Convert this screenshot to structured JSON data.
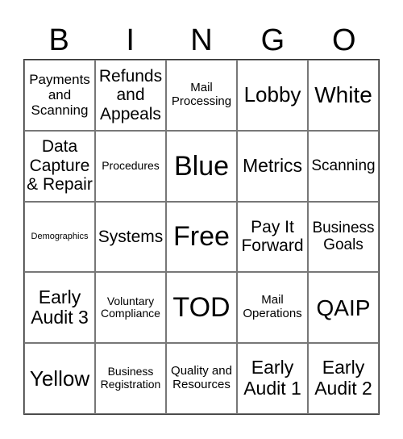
{
  "header": [
    "B",
    "I",
    "N",
    "G",
    "O"
  ],
  "cells": [
    "Payments and Scanning",
    "Refunds and Appeals",
    "Mail Processing",
    "Lobby",
    "White",
    "Data Capture & Repair",
    "Procedures",
    "Blue",
    "Metrics",
    "Scanning",
    "Demographics",
    "Systems",
    "Free",
    "Pay It Forward",
    "Business Goals",
    "Early Audit 3",
    "Voluntary Compliance",
    "TOD",
    "Mail Operations",
    "QAIP",
    "Yellow",
    "Business Registration",
    "Quality and Resources",
    "Early Audit 1",
    "Early Audit 2"
  ]
}
